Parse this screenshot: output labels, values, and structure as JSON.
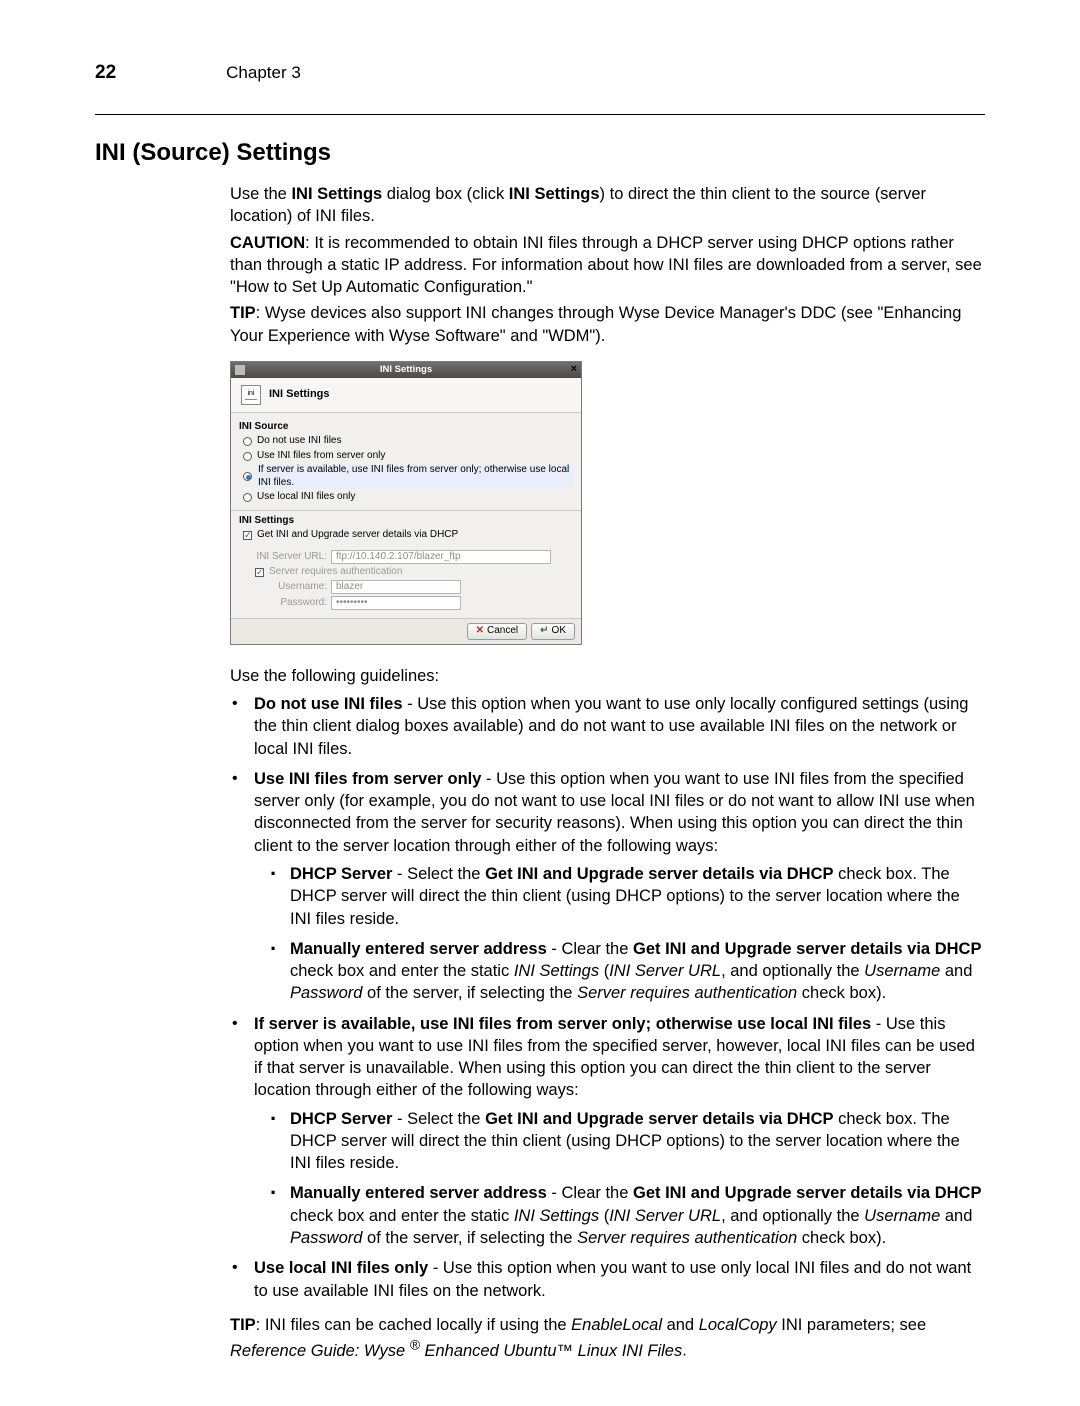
{
  "page": {
    "number": "22",
    "chapter": "Chapter 3"
  },
  "heading": "INI (Source) Settings",
  "intro": {
    "p1a": "Use the ",
    "p1b": "INI Settings",
    "p1c": " dialog box (click ",
    "p1d": "INI Settings",
    "p1e": ") to direct the thin client to the source (server location) of INI files.",
    "caution_lbl": "CAUTION",
    "caution_txt": ": It is recommended to obtain INI files through a DHCP server using DHCP options rather than through a static IP address. For information about how INI files are downloaded from a server, see \"How to Set Up Automatic Configuration.\"",
    "tip_lbl": "TIP",
    "tip_txt": ": Wyse devices also support INI changes through Wyse Device Manager's DDC (see \"Enhancing Your Experience with Wyse Software\" and \"WDM\")."
  },
  "dlg": {
    "titlebar": "INI Settings",
    "header": "INI Settings",
    "icon_text": "ini",
    "close": "×",
    "src_title": "INI Source",
    "src_opts": [
      "Do not use INI files",
      "Use INI files from server only",
      "If server is available, use INI files from server only; otherwise use local INI files.",
      "Use local INI files only"
    ],
    "set_title": "INI Settings",
    "chk_dhcp": "Get INI and Upgrade server details via DHCP",
    "url_lbl": "INI Server URL:",
    "url_val": "ftp://10.140.2.107/blazer_ftp",
    "chk_auth": "Server requires authentication",
    "user_lbl": "Username:",
    "user_val": "blazer",
    "pass_lbl": "Password:",
    "pass_val": "•••••••••",
    "btn_cancel": "Cancel",
    "btn_ok": "OK"
  },
  "guidelines_intro": "Use the following guidelines:",
  "g1": {
    "b": "Do not use INI files",
    "t": " - Use this option when you want to use only locally configured settings (using the thin client dialog boxes available) and do not want to use available INI files on the network or local INI files."
  },
  "g2": {
    "b": "Use INI files from server only",
    "t": " - Use this option when you want to use INI files from the specified server only (for example, you do not want to use local INI files or do not want to allow INI use when disconnected from the server for security reasons). When using this option you can direct the thin client to the server location through either of the following ways:"
  },
  "g2a": {
    "b": "DHCP Server",
    "t1": " - Select the ",
    "b2": "Get INI and Upgrade server details via DHCP",
    "t2": " check box. The DHCP server will direct the thin client (using DHCP options) to the server location where the INI files reside."
  },
  "g2b": {
    "b": "Manually entered server address",
    "t1": " - Clear the ",
    "b2": "Get INI and Upgrade server details via DHCP",
    "t2": " check box and enter the static ",
    "i1": "INI Settings",
    "t3": " (",
    "i2": "INI Server URL",
    "t4": ", and optionally the ",
    "i3": "Username",
    "t5": " and ",
    "i4": "Password",
    "t6": " of the server, if selecting the ",
    "i5": "Server requires authentication",
    "t7": " check box)."
  },
  "g3": {
    "b": "If server is available, use INI files from server only; otherwise use local INI files",
    "t": " - Use this option when you want to use INI files from the specified server, however, local INI files can be used if that server is unavailable. When using this option you can direct the thin client to the server location through either of the following ways:"
  },
  "g4": {
    "b": "Use local INI files only",
    "t": " - Use this option when you want to use only local INI files and do not want to use available INI files on the network."
  },
  "tip2": {
    "lbl": "TIP",
    "t1": ": INI files can be cached locally if using the ",
    "i1": "EnableLocal",
    "t2": " and ",
    "i2": "LocalCopy",
    "t3": " INI parameters; see ",
    "i3a": "Reference Guide: Wyse ",
    "sup": "®",
    "i3b": " Enhanced Ubuntu™ Linux INI Files",
    "t4": "."
  }
}
